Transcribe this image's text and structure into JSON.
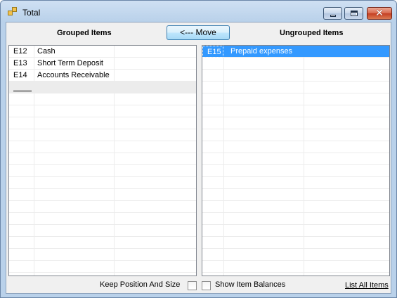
{
  "window": {
    "title": "Total",
    "icon": "window-app-icon"
  },
  "caption_buttons": {
    "minimize_icon": "minimize-icon",
    "maximize_icon": "maximize-icon",
    "close_icon": "close-icon",
    "close_glyph": "✕"
  },
  "headings": {
    "grouped": "Grouped Items",
    "ungrouped": "Ungrouped Items"
  },
  "toolbar": {
    "move_label": "<--- Move"
  },
  "grouped_items": [
    {
      "code": "E12",
      "name": "Cash"
    },
    {
      "code": "E13",
      "name": "Short Term Deposit"
    },
    {
      "code": "E14",
      "name": "Accounts Receivable"
    }
  ],
  "ungrouped_items": [
    {
      "code": "E15",
      "name": "Prepaid expenses",
      "selected": true
    }
  ],
  "footer": {
    "keep_position_label": "Keep Position And Size",
    "keep_position_checked": false,
    "show_balances_label": "Show Item Balances",
    "show_balances_checked": false,
    "list_all_label": "List All Items"
  },
  "colors": {
    "selection": "#3399ff",
    "client_background": "#f0f0f0",
    "frame": "#b9d1ea"
  }
}
